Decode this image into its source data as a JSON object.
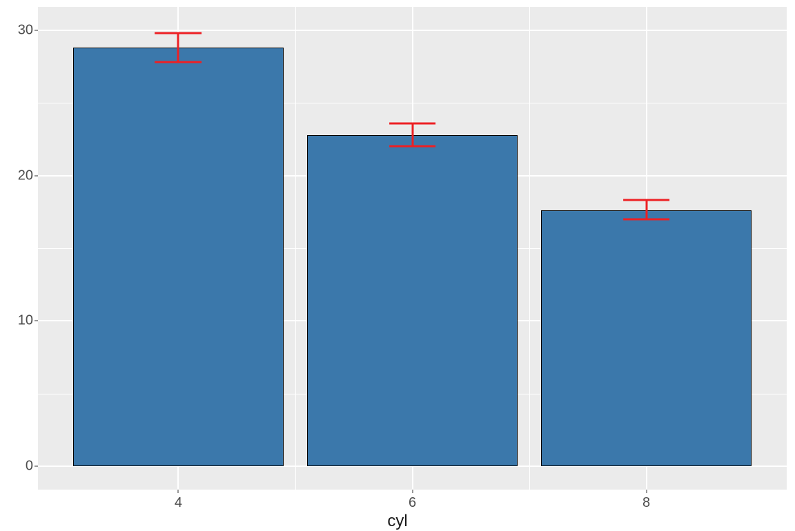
{
  "chart_data": {
    "type": "bar",
    "categories": [
      "4",
      "6",
      "8"
    ],
    "values": [
      28.8,
      22.8,
      17.6
    ],
    "error_low": [
      27.8,
      22.0,
      17.0
    ],
    "error_high": [
      29.8,
      23.6,
      18.3
    ],
    "title": "",
    "xlabel": "cyl",
    "ylabel": "",
    "ylim": [
      -1.6,
      31.6
    ],
    "y_ticks": [
      0,
      10,
      20,
      30
    ],
    "colors": {
      "bar_fill": "#3B78AB",
      "bar_outline": "#000000",
      "error_bar": "#ED2024",
      "panel_bg": "#EBEBEB",
      "grid": "#FFFFFF"
    }
  }
}
